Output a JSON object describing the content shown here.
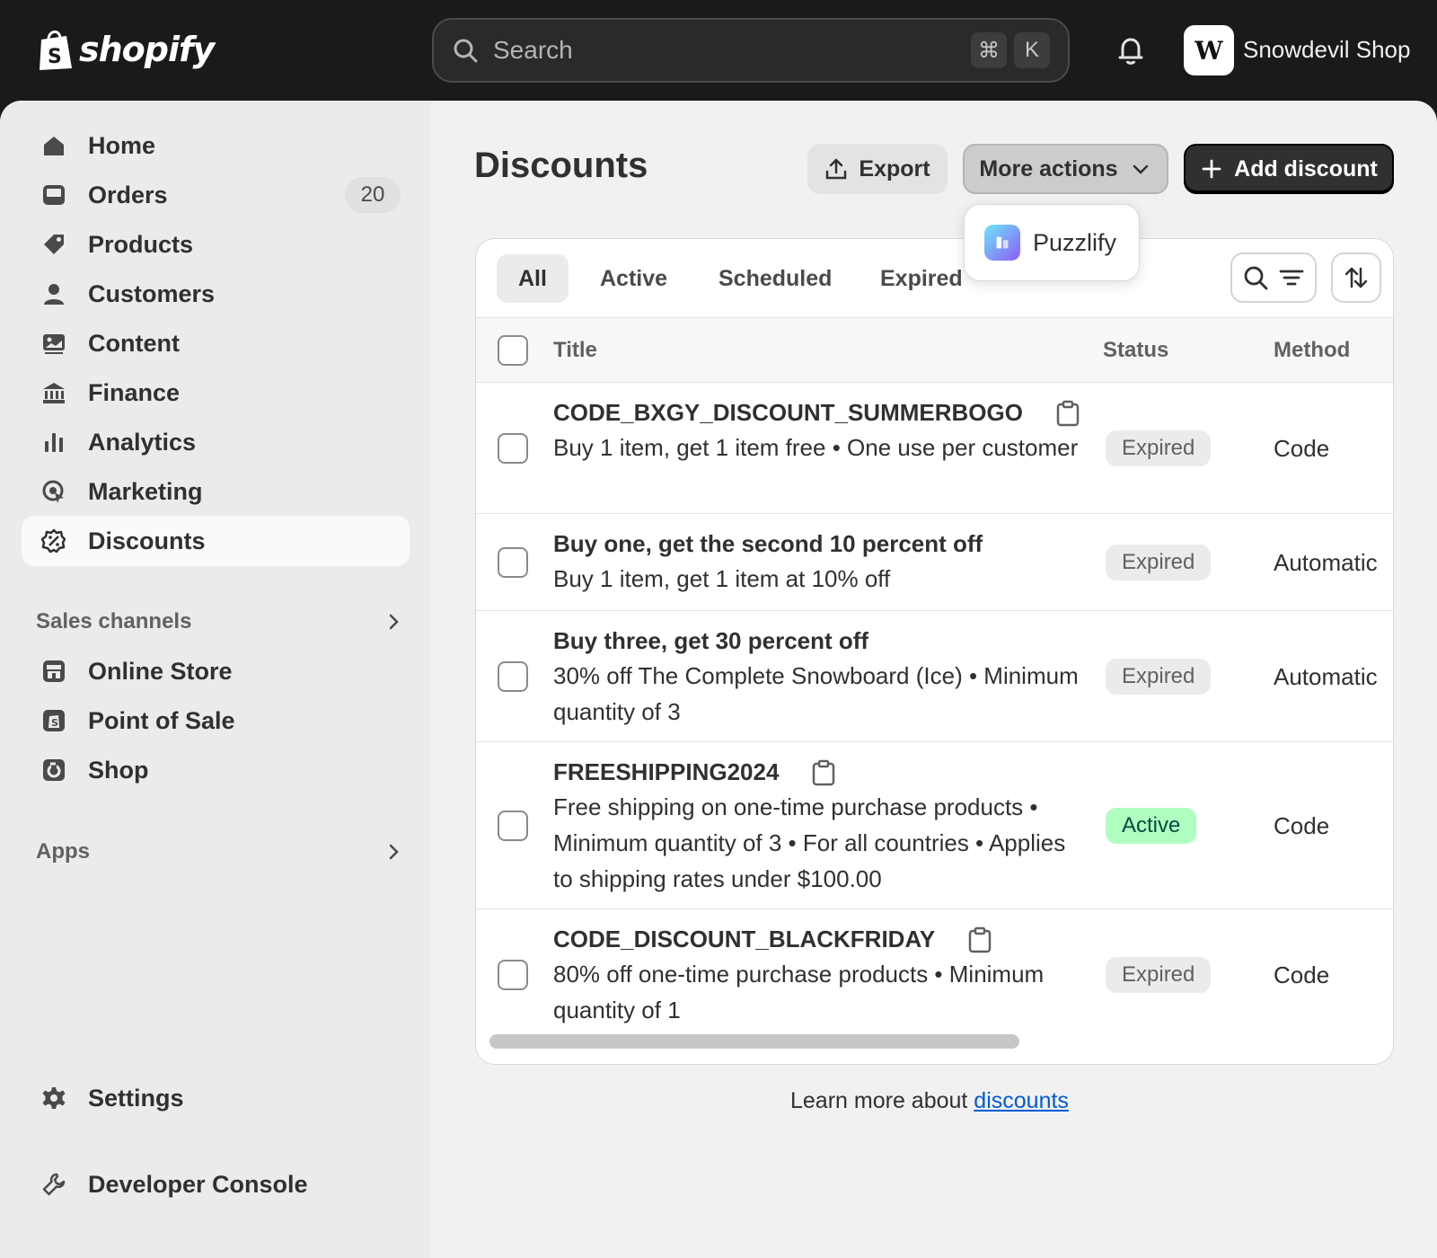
{
  "topbar": {
    "brand": "shopify",
    "search_placeholder": "Search",
    "kbd_cmd": "⌘",
    "kbd_key": "K",
    "shop_initials": "W",
    "shop_name": "Snowdevil Shop"
  },
  "sidebar": {
    "items": [
      {
        "label": "Home",
        "icon": "home-icon"
      },
      {
        "label": "Orders",
        "icon": "inbox-icon",
        "badge": "20"
      },
      {
        "label": "Products",
        "icon": "tag-icon"
      },
      {
        "label": "Customers",
        "icon": "person-icon"
      },
      {
        "label": "Content",
        "icon": "image-icon"
      },
      {
        "label": "Finance",
        "icon": "bank-icon"
      },
      {
        "label": "Analytics",
        "icon": "bar-chart-icon"
      },
      {
        "label": "Marketing",
        "icon": "target-icon"
      },
      {
        "label": "Discounts",
        "icon": "discount-icon",
        "active": true
      }
    ],
    "sales_channels_label": "Sales channels",
    "channels": [
      {
        "label": "Online Store",
        "icon": "store-icon"
      },
      {
        "label": "Point of Sale",
        "icon": "pos-icon"
      },
      {
        "label": "Shop",
        "icon": "shop-icon"
      }
    ],
    "apps_label": "Apps",
    "settings_label": "Settings",
    "developer_label": "Developer Console"
  },
  "main": {
    "title": "Discounts",
    "export_label": "Export",
    "more_actions_label": "More actions",
    "add_discount_label": "Add discount",
    "popover_item": "Puzzlify",
    "tabs": [
      "All",
      "Active",
      "Scheduled",
      "Expired"
    ],
    "columns": {
      "title": "Title",
      "status": "Status",
      "method": "Method"
    },
    "rows": [
      {
        "title": "CODE_BXGY_DISCOUNT_SUMMERBOGO",
        "copy": true,
        "desc": "Buy 1 item, get 1 item free • One use per customer",
        "status": "Expired",
        "method": "Code"
      },
      {
        "title": "Buy one, get the second 10 percent off",
        "copy": false,
        "desc": "Buy 1 item, get 1 item at 10% off",
        "status": "Expired",
        "method": "Automatic"
      },
      {
        "title": "Buy three, get 30 percent off",
        "copy": false,
        "desc": "30% off The Complete Snowboard (Ice) • Minimum quantity of 3",
        "status": "Expired",
        "method": "Automatic"
      },
      {
        "title": "FREESHIPPING2024",
        "copy": true,
        "desc": "Free shipping on one-time purchase products • Minimum quantity of 3 • For all countries • Applies to shipping rates under $100.00",
        "status": "Active",
        "method": "Code"
      },
      {
        "title": "CODE_DISCOUNT_BLACKFRIDAY",
        "copy": true,
        "desc": "80% off one-time purchase products • Minimum quantity of 1",
        "status": "Expired",
        "method": "Code"
      }
    ],
    "footer_text": "Learn more about ",
    "footer_link": "discounts"
  }
}
